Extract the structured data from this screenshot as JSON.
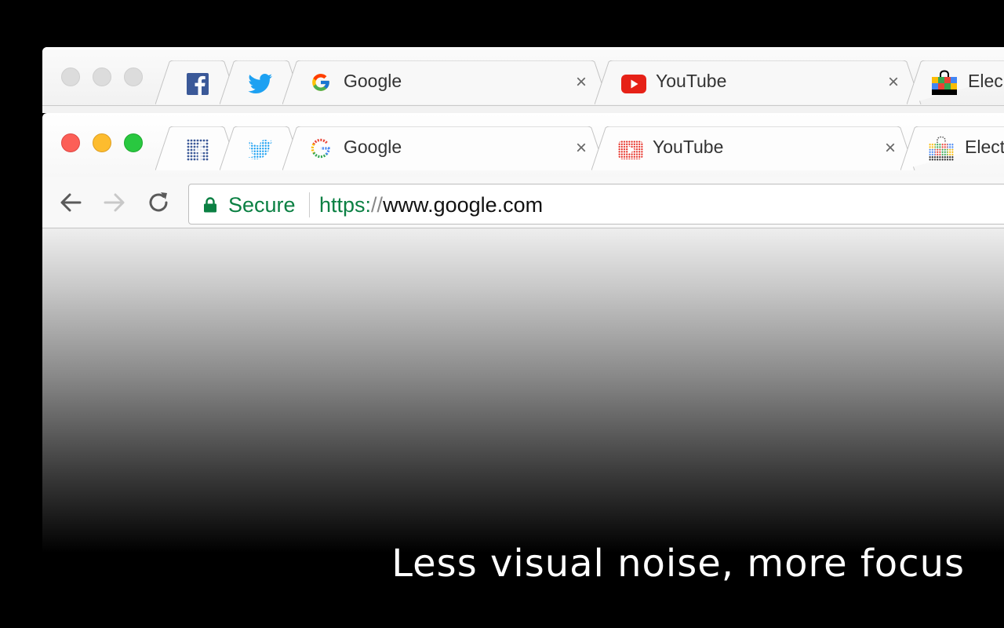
{
  "back_window": {
    "tabs": [
      {
        "icon": "facebook-icon"
      },
      {
        "icon": "twitter-icon"
      },
      {
        "icon": "google-icon",
        "title": "Google",
        "close": "×"
      },
      {
        "icon": "youtube-icon",
        "title": "YouTube",
        "close": "×"
      },
      {
        "icon": "shopping-bag-icon",
        "title": "Elec"
      }
    ]
  },
  "front_window": {
    "tabs": [
      {
        "icon": "facebook-icon"
      },
      {
        "icon": "twitter-icon"
      },
      {
        "icon": "google-icon",
        "title": "Google",
        "close": "×"
      },
      {
        "icon": "youtube-icon",
        "title": "YouTube",
        "close": "×"
      },
      {
        "icon": "shopping-bag-icon",
        "title": "Elect"
      }
    ],
    "toolbar": {
      "back_icon": "arrow-left-icon",
      "forward_icon": "arrow-right-icon",
      "reload_icon": "reload-icon",
      "security_label": "Secure",
      "url_scheme": "https:",
      "url_slashes": "//",
      "url_host": "www.google.com"
    }
  },
  "caption": "Less visual noise, more focus",
  "colors": {
    "secure_green": "#0b8043",
    "close_red": "#fc5f57",
    "minimize_yellow": "#fdbc2e",
    "zoom_green": "#29c840"
  }
}
